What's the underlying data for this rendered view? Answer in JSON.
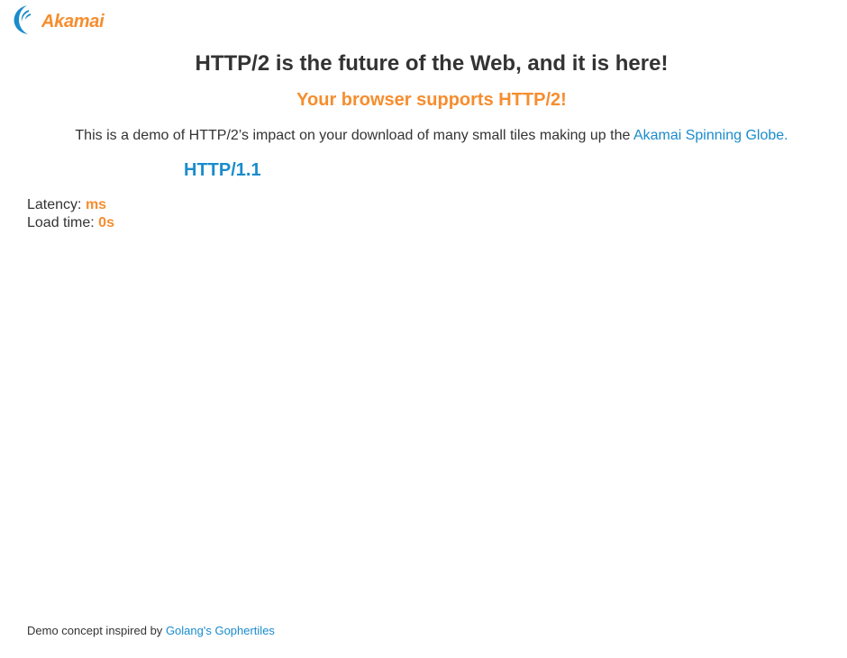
{
  "brand": {
    "logo_text": "Akamai",
    "logo_icon": "akamai-swoosh-logo",
    "color_blue": "#1a8ccc",
    "color_orange": "#f68d2e"
  },
  "main": {
    "headline": "HTTP/2 is the future of the Web, and it is here!",
    "support_message": "Your browser supports HTTP/2!",
    "intro_prefix": "This is a demo of HTTP/2’s impact on your download of many small tiles making up the",
    "intro_link": "Akamai Spinning Globe",
    "intro_suffix": ".",
    "protocol_label": "HTTP/1.1"
  },
  "stats": {
    "latency_label": "Latency:",
    "latency_value": "ms",
    "load_time_label": "Load time:",
    "load_time_value": "0s"
  },
  "footer": {
    "prefix": "Demo concept inspired by",
    "link": "Golang's Gophertiles"
  }
}
